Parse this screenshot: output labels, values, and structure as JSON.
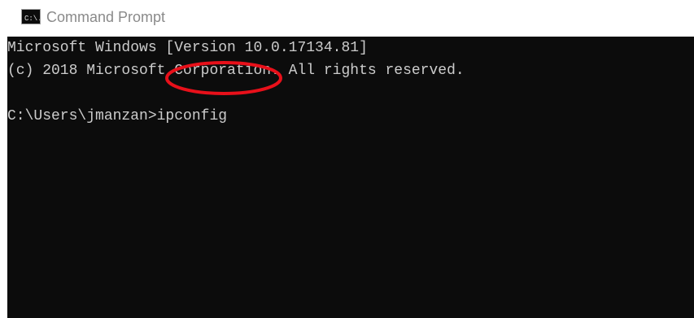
{
  "window": {
    "title": "Command Prompt",
    "icon": "cmd-icon",
    "icon_glyph": "C:\\."
  },
  "console": {
    "background": "#0c0c0c",
    "text_color": "#cccccc",
    "lines": [
      "Microsoft Windows [Version 10.0.17134.81]",
      "(c) 2018 Microsoft Corporation. All rights reserved.",
      "",
      "C:\\Users\\jmanzan>ipconfig"
    ]
  },
  "annotation": {
    "color": "#e8101a",
    "shape": "ellipse"
  }
}
